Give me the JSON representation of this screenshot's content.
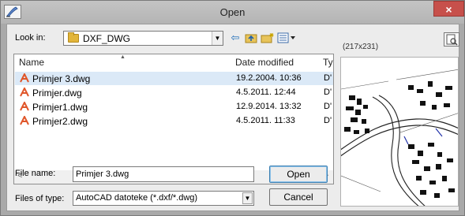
{
  "window": {
    "title": "Open",
    "close_glyph": "×"
  },
  "look_in": {
    "label": "Look in:",
    "value": "DXF_DWG",
    "folder_icon": "folder-icon"
  },
  "toolbar": {
    "back_icon": "⇦",
    "up_icon": "up-folder-icon",
    "new_folder_icon": "new-folder-icon",
    "views_icon": "views-icon"
  },
  "preview": {
    "dims": "(217x231)"
  },
  "file_list": {
    "columns": {
      "name": "Name",
      "date": "Date modified",
      "type": "Ty"
    },
    "rows": [
      {
        "name": "Primjer 3.dwg",
        "date": "19.2.2004. 10:36",
        "type": "D'",
        "selected": true
      },
      {
        "name": "Primjer.dwg",
        "date": "4.5.2011. 12:44",
        "type": "D'",
        "selected": false
      },
      {
        "name": "Primjer1.dwg",
        "date": "12.9.2014. 13:32",
        "type": "D'",
        "selected": false
      },
      {
        "name": "Primjer2.dwg",
        "date": "4.5.2011. 11:33",
        "type": "D'",
        "selected": false
      }
    ],
    "scroll_left": "<",
    "scroll_right": ">"
  },
  "file_name": {
    "label": "File name:",
    "value": "Primjer 3.dwg"
  },
  "file_type": {
    "label": "Files of type:",
    "value": "AutoCAD datoteke (*.dxf/*.dwg)"
  },
  "buttons": {
    "open": "Open",
    "cancel": "Cancel"
  },
  "colors": {
    "title_bar": "#b4b4b4",
    "close": "#c7504b",
    "selection": "#dbe9f7",
    "accent": "#3c7fb1"
  }
}
